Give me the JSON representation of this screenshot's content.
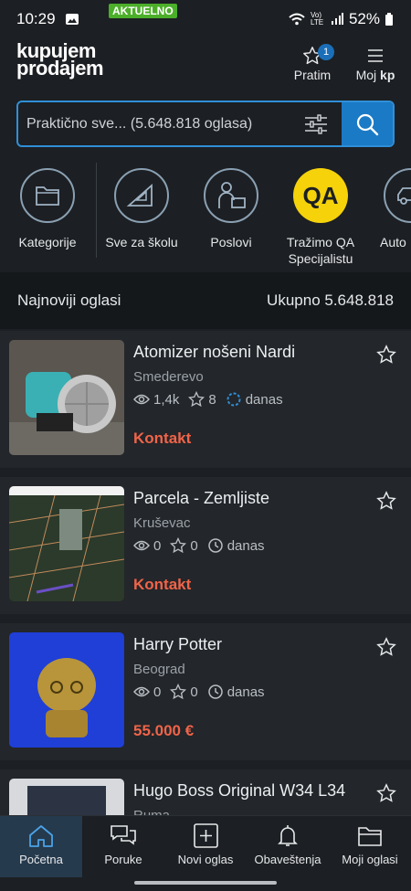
{
  "status": {
    "time": "10:29",
    "network": "Vo))\nLTE",
    "battery": "52%"
  },
  "header": {
    "logo_line1": "kupujem",
    "logo_line2": "prodajem",
    "pratim_label": "Pratim",
    "pratim_count": "1",
    "moj_label": "Moj",
    "moj_bold": "kp"
  },
  "search": {
    "placeholder": "Praktično sve... (5.648.818 oglasa)"
  },
  "categories": [
    {
      "label": "Kategorije"
    },
    {
      "label": "Sve za školu",
      "badge": "AKTUELNO"
    },
    {
      "label": "Poslovi"
    },
    {
      "label": "Tražimo QA Specijalistu",
      "logo": "QA"
    },
    {
      "label": "Auto"
    }
  ],
  "section": {
    "left": "Najnoviji oglasi",
    "right": "Ukupno 5.648.818"
  },
  "listings": [
    {
      "title": "Atomizer nošeni Nardi",
      "city": "Smederevo",
      "views": "1,4k",
      "favs": "8",
      "time": "danas",
      "price": "Kontakt"
    },
    {
      "title": "Parcela - Zemljiste",
      "city": "Kruševac",
      "views": "0",
      "favs": "0",
      "time": "danas",
      "price": "Kontakt"
    },
    {
      "title": "Harry Potter",
      "city": "Beograd",
      "views": "0",
      "favs": "0",
      "time": "danas",
      "price": "55.000 €"
    },
    {
      "title": "Hugo Boss Original W34 L34",
      "city": "Ruma"
    }
  ],
  "nav": [
    {
      "label": "Početna",
      "active": true
    },
    {
      "label": "Poruke"
    },
    {
      "label": "Novi oglas"
    },
    {
      "label": "Obaveštenja"
    },
    {
      "label": "Moji oglasi"
    }
  ],
  "colors": {
    "accent": "#1b7ac6",
    "price": "#f06449",
    "badge": "#4caf2a",
    "qa": "#f5d20a"
  }
}
